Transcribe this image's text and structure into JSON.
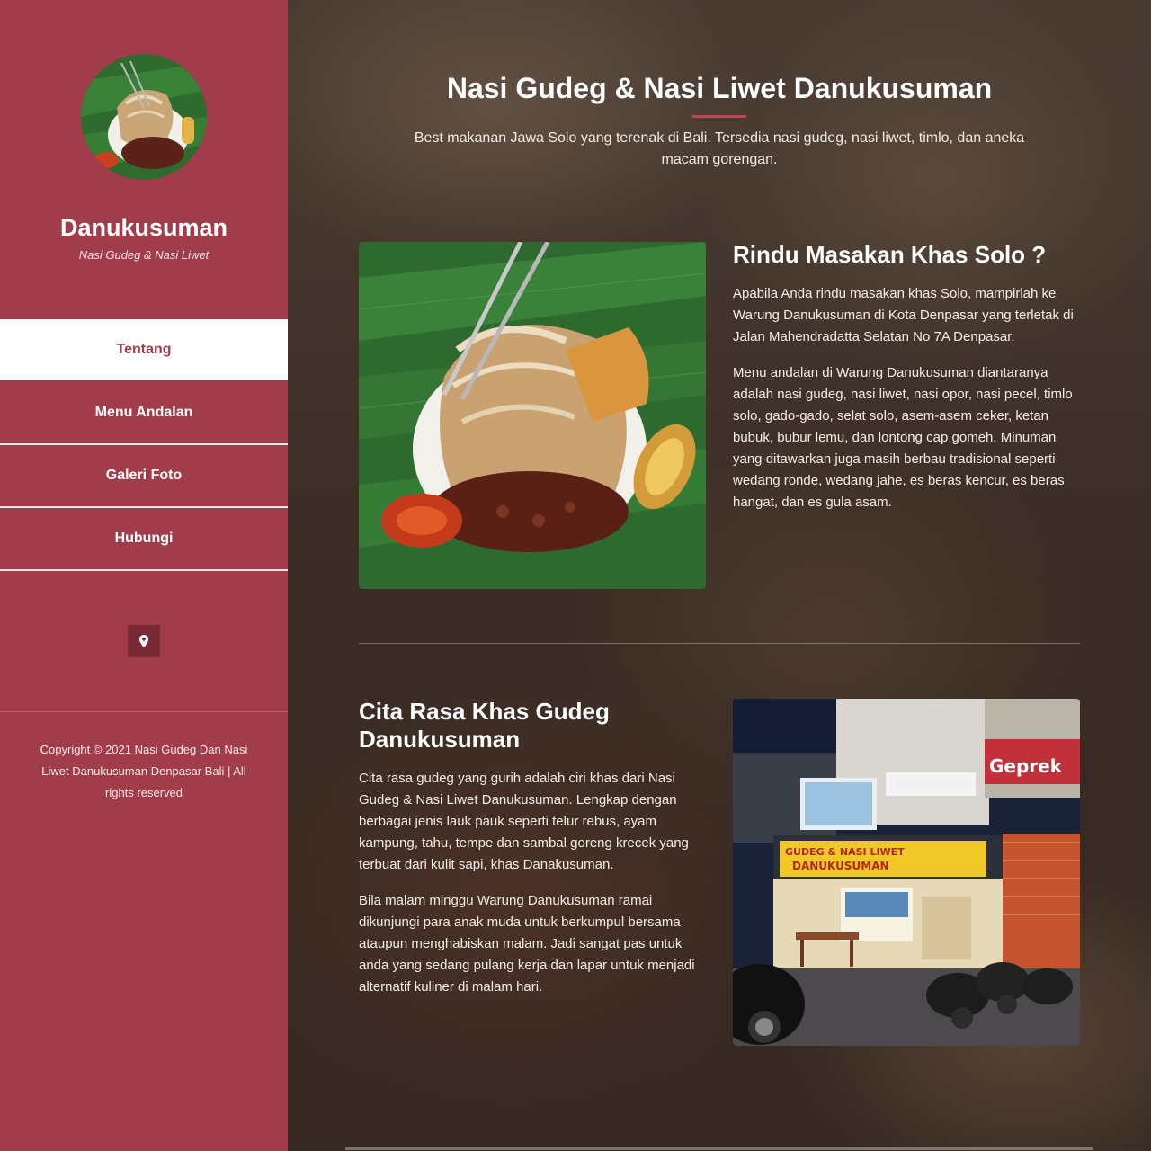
{
  "sidebar": {
    "site_title": "Danukusuman",
    "tagline": "Nasi Gudeg & Nasi Liwet",
    "nav": [
      {
        "label": "Tentang",
        "active": true
      },
      {
        "label": "Menu Andalan",
        "active": false
      },
      {
        "label": "Galeri Foto",
        "active": false
      },
      {
        "label": "Hubungi",
        "active": false
      }
    ],
    "social_icon": "map-marker-icon",
    "copyright": "Copyright © 2021 Nasi Gudeg Dan Nasi Liwet Danukusuman Denpasar Bali | All rights reserved"
  },
  "main": {
    "heading": "Nasi Gudeg & Nasi Liwet Danukusuman",
    "lead": "Best makanan Jawa Solo yang terenak di Bali. Tersedia nasi gudeg, nasi liwet, timlo, dan aneka macam gorengan.",
    "section1": {
      "title": "Rindu Masakan Khas Solo ?",
      "paragraphs": [
        "Apabila Anda rindu masakan khas Solo, mampirlah ke Warung Danukusuman di Kota Denpasar yang terletak di Jalan Mahendradatta Selatan No 7A Denpasar.",
        "Menu andalan di Warung Danukusuman diantaranya adalah nasi gudeg, nasi liwet, nasi opor, nasi pecel, timlo solo, gado-gado, selat solo, asem-asem ceker, ketan bubuk, bubur lemu, dan lontong cap gomeh. Minuman yang ditawarkan juga masih berbau tradisional seperti wedang ronde, wedang jahe, es beras kencur, es beras hangat, dan es gula asam."
      ]
    },
    "section2": {
      "title": "Cita Rasa Khas Gudeg Danukusuman",
      "paragraphs": [
        "Cita rasa gudeg yang gurih adalah ciri khas dari Nasi Gudeg & Nasi Liwet Danukusuman. Lengkap dengan berbagai jenis lauk pauk seperti telur rebus, ayam kampung, tahu, tempe dan sambal goreng krecek yang terbuat dari kulit sapi, khas Danakusuman.",
        "Bila malam minggu Warung Danukusuman ramai dikunjungi para anak muda untuk berkumpul bersama ataupun menghabiskan malam. Jadi sangat pas untuk anda yang sedang pulang kerja dan lapar untuk menjadi alternatif kuliner di malam hari."
      ]
    },
    "shop_photo": {
      "banner_line1": "GUDEG & NASI LIWET",
      "banner_line2": "DANUKUSUMAN",
      "neighbor_sign": "Geprek"
    }
  },
  "colors": {
    "sidebar": "#a13d4a",
    "accent": "#b5495a",
    "active_nav_bg": "#ffffff"
  }
}
